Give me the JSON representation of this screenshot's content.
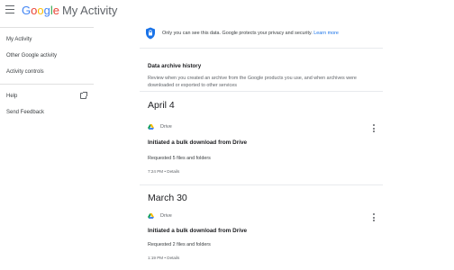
{
  "header": {
    "logo_letters": [
      "G",
      "o",
      "o",
      "g",
      "l",
      "e"
    ],
    "app_name": "My Activity"
  },
  "sidebar": {
    "items": [
      {
        "label": "My Activity"
      },
      {
        "label": "Other Google activity"
      },
      {
        "label": "Activity controls"
      }
    ],
    "footer_items": [
      {
        "label": "Help"
      },
      {
        "label": "Send Feedback"
      }
    ]
  },
  "privacy": {
    "text": "Only you can see this data. Google protects your privacy and security.",
    "link": "Learn more"
  },
  "archive": {
    "title": "Data archive history",
    "description": "Review when you created an archive from the Google products you use, and when archives were downloaded or exported to other services"
  },
  "activities": [
    {
      "date": "April 4",
      "product": "Drive",
      "title": "Initiated a bulk download from Drive",
      "subtitle": "Requested 5 files and folders",
      "time": "7:24 PM",
      "details": "Details"
    },
    {
      "date": "March 30",
      "product": "Drive",
      "title": "Initiated a bulk download from Drive",
      "subtitle": "Requested 2 files and folders",
      "time": "1:19 PM",
      "details": "Details"
    }
  ],
  "colors": {
    "accent": "#1a73e8",
    "shield": "#1a73e8"
  }
}
